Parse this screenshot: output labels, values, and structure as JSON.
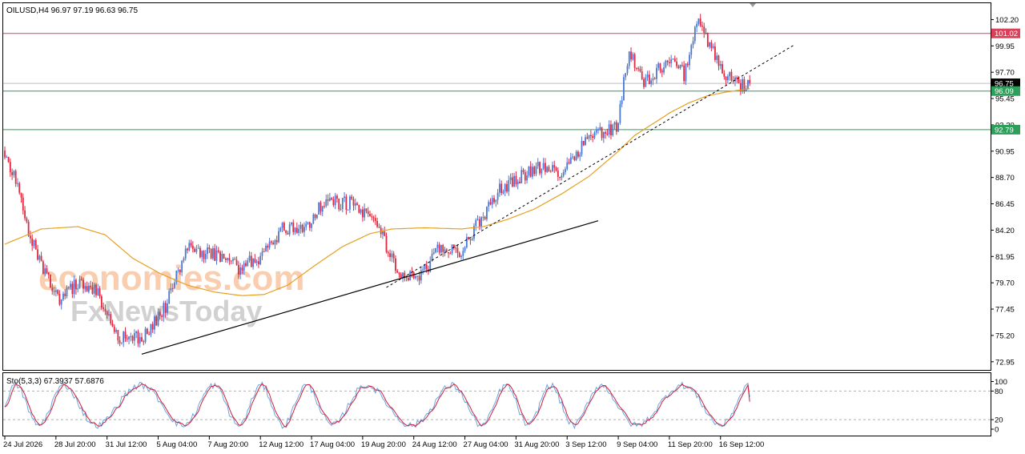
{
  "chart_data": {
    "type": "candlestick",
    "symbol_header": "OILUSD,H4  96.97 97.19 96.63 96.75",
    "indicator_header": "Sto(5,3,3) 67.3937 57.6876",
    "ylim": [
      72.25,
      103.6
    ],
    "y_ticks": [
      "102.20",
      "99.95",
      "97.70",
      "95.45",
      "93.20",
      "90.95",
      "88.70",
      "86.45",
      "84.20",
      "81.95",
      "79.70",
      "77.45",
      "75.20",
      "72.95"
    ],
    "x_ticks": [
      "24 Jul 2026",
      "28 Jul 20:00",
      "31 Jul 12:00",
      "5 Aug 04:00",
      "7 Aug 20:00",
      "12 Aug 12:00",
      "17 Aug 04:00",
      "19 Aug 20:00",
      "24 Aug 12:00",
      "27 Aug 04:00",
      "31 Aug 20:00",
      "3 Sep 12:00",
      "9 Sep 04:00",
      "11 Sep 20:00",
      "16 Sep 12:00"
    ],
    "stoch_ticks": [
      "100",
      "80",
      "20",
      "0"
    ],
    "stoch_levels": [
      20,
      80
    ],
    "levels": [
      {
        "value": 101.02,
        "label": "101.02",
        "color": "#d9415a"
      },
      {
        "value": 96.75,
        "label": "96.75",
        "color": "#000000"
      },
      {
        "value": 96.09,
        "label": "96.09",
        "color": "#2e9e5b"
      },
      {
        "value": 92.79,
        "label": "92.79",
        "color": "#2e9e5b"
      }
    ],
    "price_anchors": [
      [
        0,
        91.0
      ],
      [
        8,
        87.5
      ],
      [
        12,
        84.6
      ],
      [
        20,
        81.0
      ],
      [
        30,
        78.2
      ],
      [
        40,
        79.8
      ],
      [
        50,
        79.2
      ],
      [
        62,
        75.0
      ],
      [
        75,
        75.0
      ],
      [
        88,
        77.6
      ],
      [
        100,
        82.8
      ],
      [
        115,
        82.0
      ],
      [
        128,
        81.0
      ],
      [
        140,
        81.9
      ],
      [
        152,
        84.3
      ],
      [
        165,
        84.5
      ],
      [
        175,
        86.6
      ],
      [
        190,
        86.5
      ],
      [
        205,
        84.6
      ],
      [
        215,
        80.4
      ],
      [
        228,
        80.3
      ],
      [
        238,
        82.6
      ],
      [
        250,
        82.4
      ],
      [
        262,
        85.5
      ],
      [
        272,
        87.8
      ],
      [
        290,
        89.5
      ],
      [
        305,
        89.2
      ],
      [
        320,
        92.3
      ],
      [
        335,
        93.0
      ],
      [
        342,
        99.5
      ],
      [
        350,
        96.7
      ],
      [
        365,
        99.0
      ],
      [
        372,
        97.5
      ],
      [
        380,
        102.2
      ],
      [
        392,
        98.0
      ],
      [
        402,
        96.4
      ],
      [
        408,
        96.75
      ]
    ],
    "ma_anchors": [
      [
        0,
        83.0
      ],
      [
        20,
        84.3
      ],
      [
        40,
        84.5
      ],
      [
        55,
        83.8
      ],
      [
        70,
        81.8
      ],
      [
        85,
        80.5
      ],
      [
        100,
        79.5
      ],
      [
        115,
        78.9
      ],
      [
        130,
        78.6
      ],
      [
        142,
        78.7
      ],
      [
        155,
        79.5
      ],
      [
        170,
        81.2
      ],
      [
        185,
        82.8
      ],
      [
        200,
        83.9
      ],
      [
        212,
        84.3
      ],
      [
        230,
        84.4
      ],
      [
        250,
        84.3
      ],
      [
        262,
        84.5
      ],
      [
        275,
        85.1
      ],
      [
        290,
        86.0
      ],
      [
        305,
        87.3
      ],
      [
        320,
        88.8
      ],
      [
        335,
        90.8
      ],
      [
        345,
        92.3
      ],
      [
        355,
        93.3
      ],
      [
        365,
        94.3
      ],
      [
        375,
        95.1
      ],
      [
        385,
        95.7
      ],
      [
        395,
        96.0
      ],
      [
        408,
        96.3
      ]
    ],
    "trendlines": [
      {
        "style": "solid",
        "from": [
          75,
          73.6
        ],
        "to": [
          325,
          85.0
        ]
      },
      {
        "style": "dashed",
        "from": [
          209,
          79.3
        ],
        "to": [
          432,
          100.0
        ]
      }
    ],
    "watermark": [
      "economies.com",
      "FxNewsToday"
    ]
  }
}
